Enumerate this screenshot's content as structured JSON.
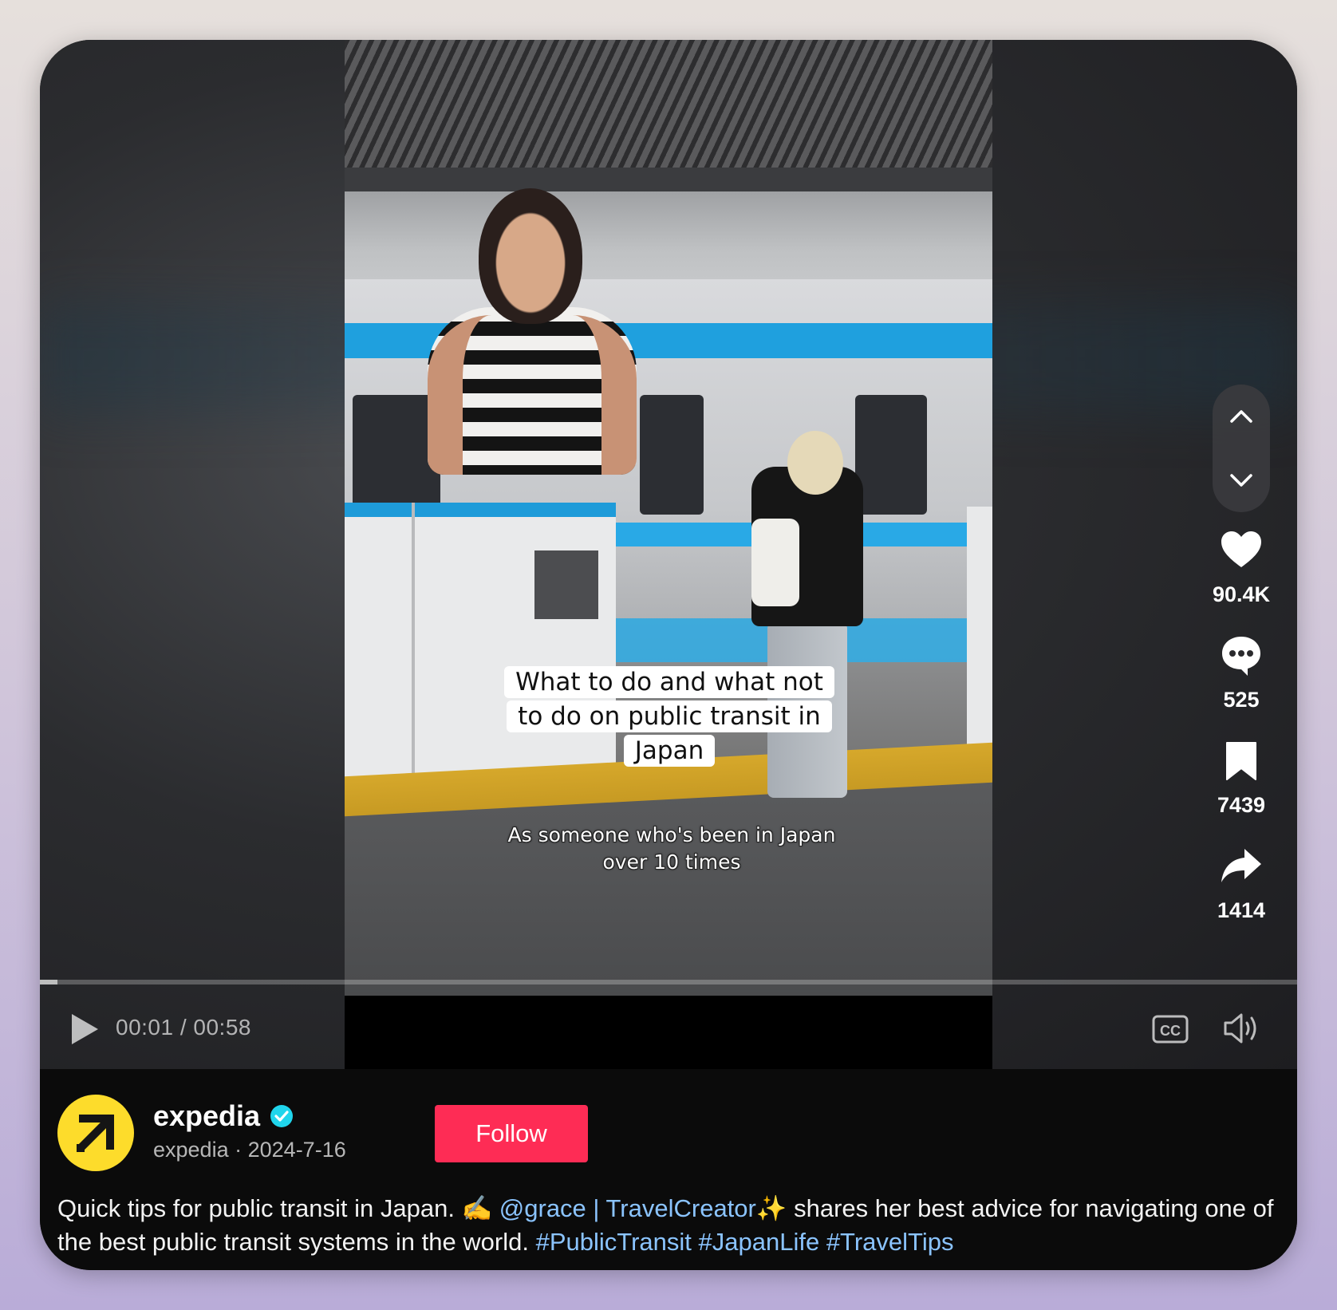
{
  "video": {
    "caption_overlay": "What to do and what not to do on public transit in Japan",
    "sub_caption": "As someone who's been in Japan over 10 times",
    "time_display": "00:01 / 00:58",
    "progress": 0.014
  },
  "actions": {
    "likes": "90.4K",
    "comments": "525",
    "saves": "7439",
    "shares": "1414"
  },
  "author": {
    "username": "expedia",
    "handle": "expedia",
    "separator": "·",
    "date": "2024-7-16",
    "verified": true
  },
  "follow_label": "Follow",
  "description": {
    "text_start": "Quick tips for public transit in Japan. ✍️ ",
    "mention": "@grace",
    "separator": " | ",
    "creator_tag": "TravelCreator✨",
    "text_mid": " shares her best advice for navigating one of the best public transit systems in the world. ",
    "hashtags": [
      "#PublicTransit",
      "#JapanLife",
      "#TravelTips"
    ]
  },
  "colors": {
    "follow": "#fe2c55",
    "link": "#8bc4ff",
    "avatar_bg": "#fddc2b",
    "verified": "#20d5ec"
  }
}
